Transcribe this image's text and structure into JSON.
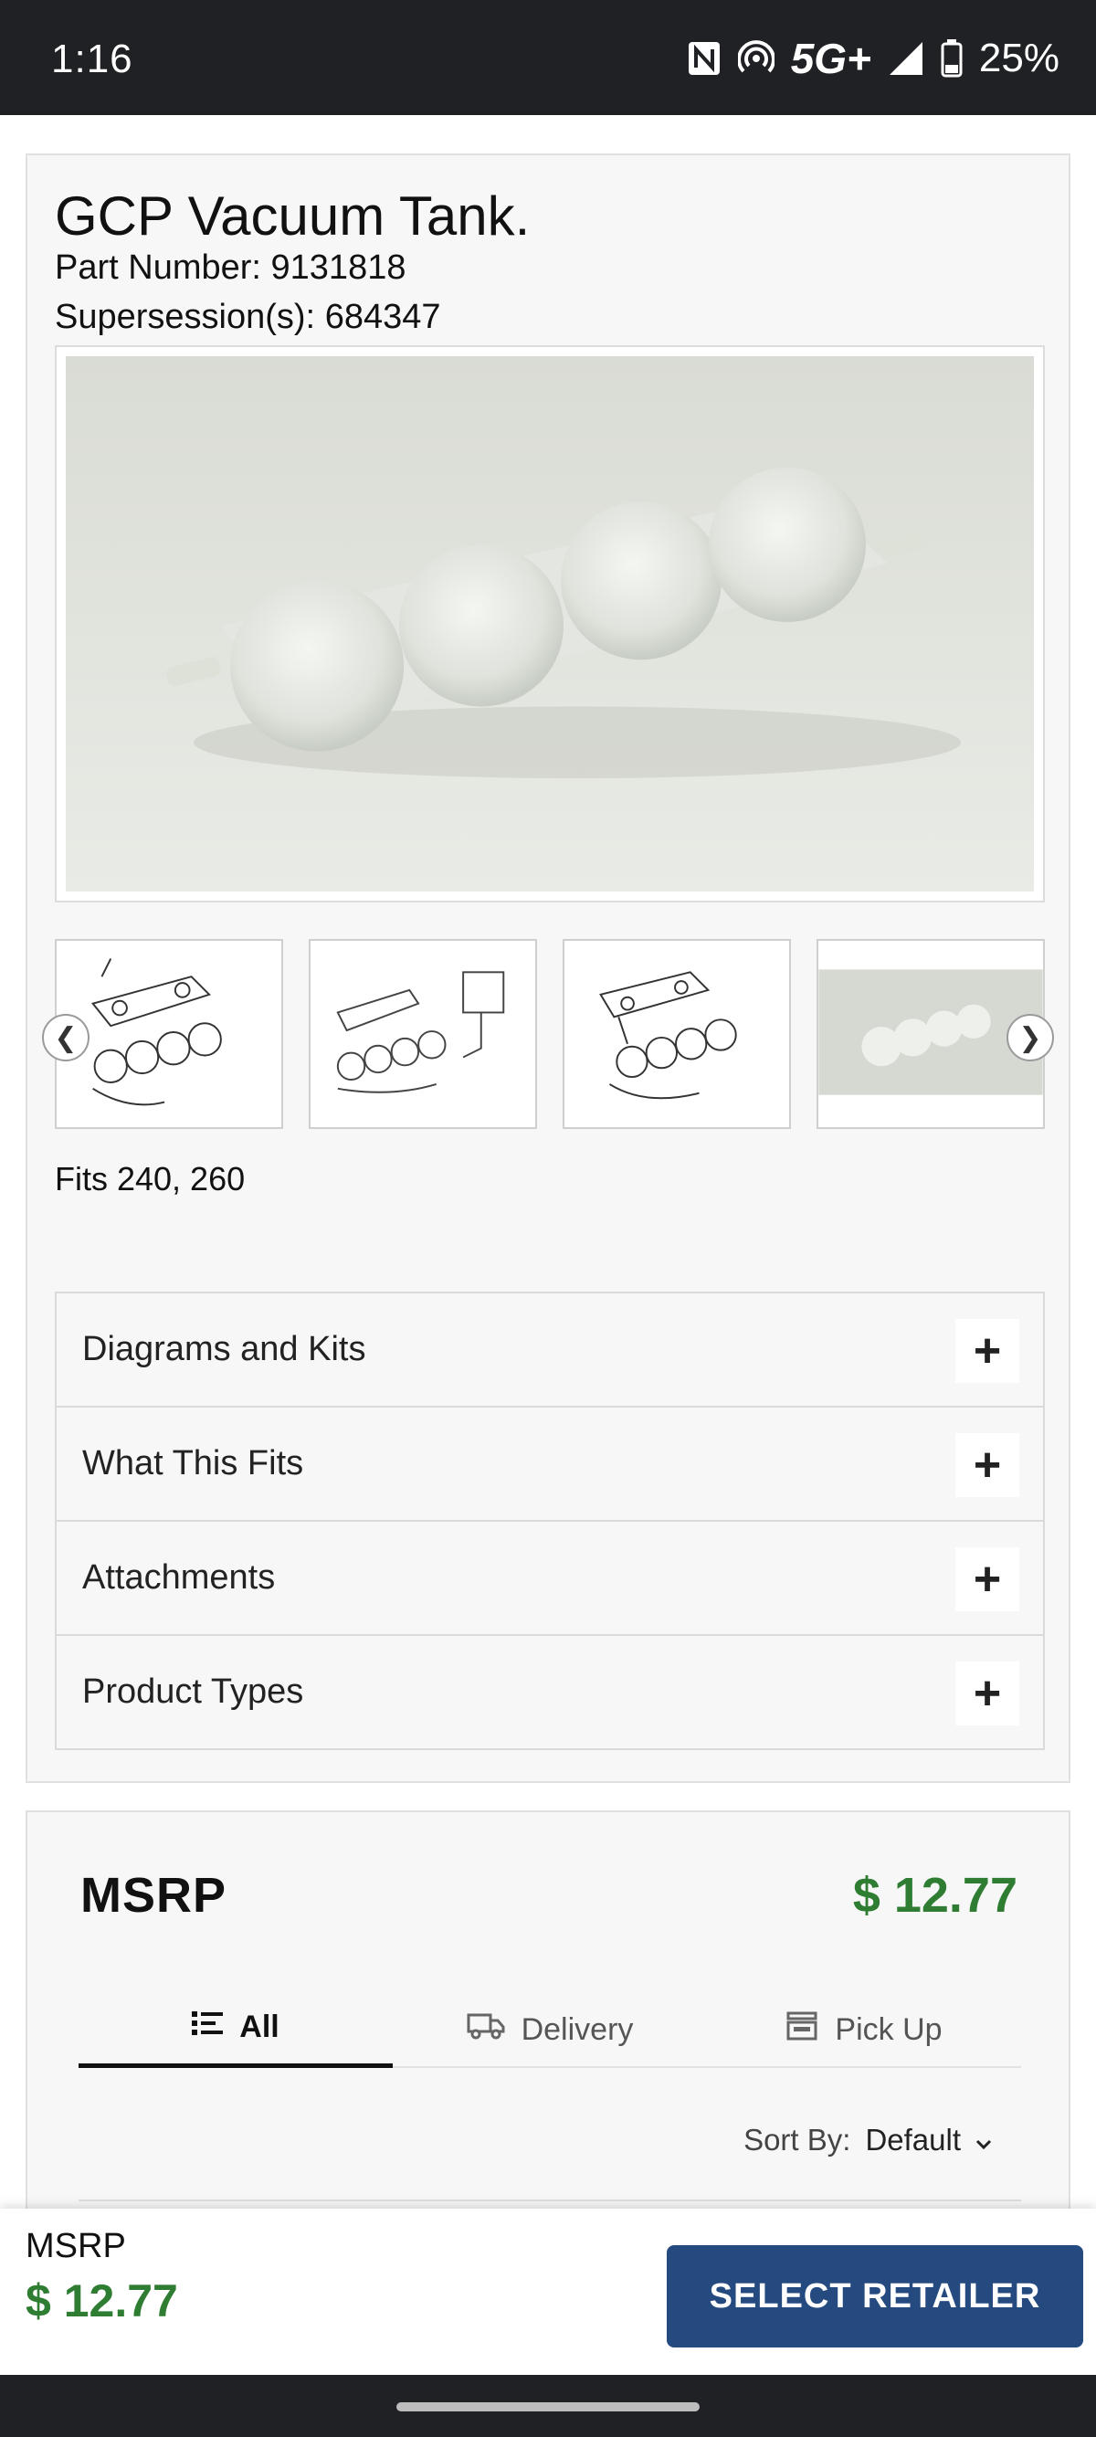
{
  "status_bar": {
    "time": "1:16",
    "network": "5G+",
    "battery": "25%",
    "icons": [
      "nfc-icon",
      "hotspot-icon",
      "signal-icon",
      "battery-icon"
    ]
  },
  "product": {
    "title": "GCP Vacuum Tank.",
    "part_number_label": "Part Number:",
    "part_number": "9131818",
    "supersession_label": "Supersession(s):",
    "supersession": "684347",
    "fits": "Fits 240, 260",
    "thumbnails": [
      "diagram-1",
      "diagram-2",
      "diagram-3",
      "photo"
    ]
  },
  "accordion": [
    {
      "label": "Diagrams and Kits"
    },
    {
      "label": "What This Fits"
    },
    {
      "label": "Attachments"
    },
    {
      "label": "Product Types"
    }
  ],
  "pricing": {
    "msrp_label": "MSRP",
    "msrp_price": "$ 12.77",
    "tabs": [
      {
        "label": "All",
        "icon": "list-icon",
        "active": true
      },
      {
        "label": "Delivery",
        "icon": "truck-icon",
        "active": false
      },
      {
        "label": "Pick Up",
        "icon": "store-icon",
        "active": false
      }
    ],
    "sort_label": "Sort By:",
    "sort_value": "Default"
  },
  "bottom_bar": {
    "label": "MSRP",
    "price": "$ 12.77",
    "button": "SELECT RETAILER"
  },
  "colors": {
    "price_green": "#2e7d32",
    "button_blue": "#254a80",
    "status_bg": "#202124"
  }
}
